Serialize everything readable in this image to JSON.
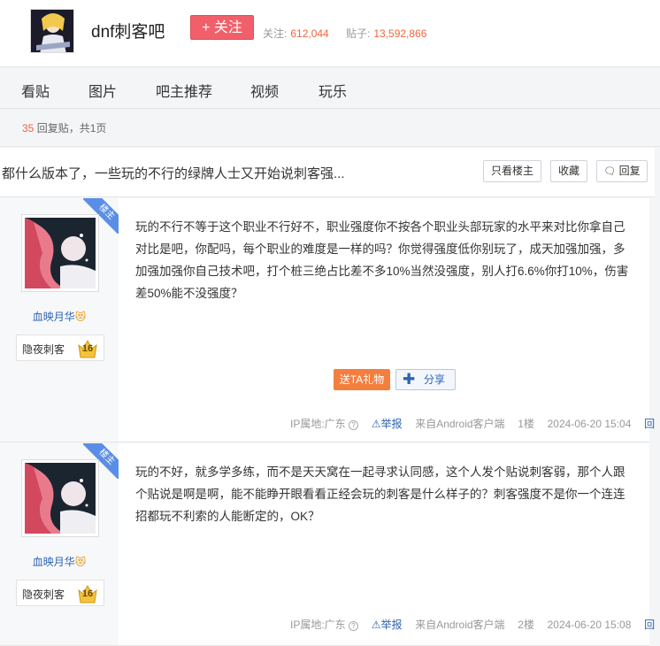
{
  "header": {
    "bar_name": "dnf刺客吧",
    "follow_label": "+ 关注",
    "follow_stat_label": "关注:",
    "follow_stat_value": "612,044",
    "posts_stat_label": "贴子:",
    "posts_stat_value": "13,592,866"
  },
  "nav": {
    "items": [
      {
        "label": "看贴"
      },
      {
        "label": "图片"
      },
      {
        "label": "吧主推荐"
      },
      {
        "label": "视频"
      },
      {
        "label": "玩乐"
      }
    ]
  },
  "pageinfo": {
    "reply_count": "35",
    "text": "回复贴，共",
    "pages": "1",
    "page_unit": "页"
  },
  "thread": {
    "title": "都什么版本了，一些玩的不行的绿牌人士又开始说刺客强...",
    "only_op_label": "只看楼主",
    "favorite_label": "收藏",
    "reply_label": "回复"
  },
  "posts": [
    {
      "op_badge": "楼主",
      "username": "血映月华",
      "user_emoji": "😻",
      "badge_name": "隐夜刺客",
      "badge_level": "16",
      "content": "玩的不行不等于这个职业不行好不，职业强度你不按各个职业头部玩家的水平来对比你拿自己对比是吧，你配吗，每个职业的难度是一样的吗？你觉得强度低你别玩了，成天加强加强，多加强加强你自己技术吧，打个桩三绝占比差不多10%当然没强度，别人打6.6%你打10%，伤害差50%能不没强度？",
      "gift_label": "送TA礼物",
      "share_label": "分享",
      "ip_label": "IP属地:广东",
      "report_label": "举报",
      "source": "来自Android客户端",
      "floor": "1楼",
      "time": "2024-06-20 15:04",
      "reply_label": "回复"
    },
    {
      "op_badge": "楼主",
      "username": "血映月华",
      "user_emoji": "😻",
      "badge_name": "隐夜刺客",
      "badge_level": "16",
      "content": "玩的不好，就多学多练，而不是天天窝在一起寻求认同感，这个人发个贴说刺客弱，那个人跟个贴说是啊是啊，能不能睁开眼看看正经会玩的刺客是什么样子的？刺客强度不是你一个连连招都玩不利索的人能断定的，OK？",
      "ip_label": "IP属地:广东",
      "report_label": "举报",
      "source": "来自Android客户端",
      "floor": "2楼",
      "time": "2024-06-20 15:08",
      "reply_label": "回复"
    }
  ]
}
